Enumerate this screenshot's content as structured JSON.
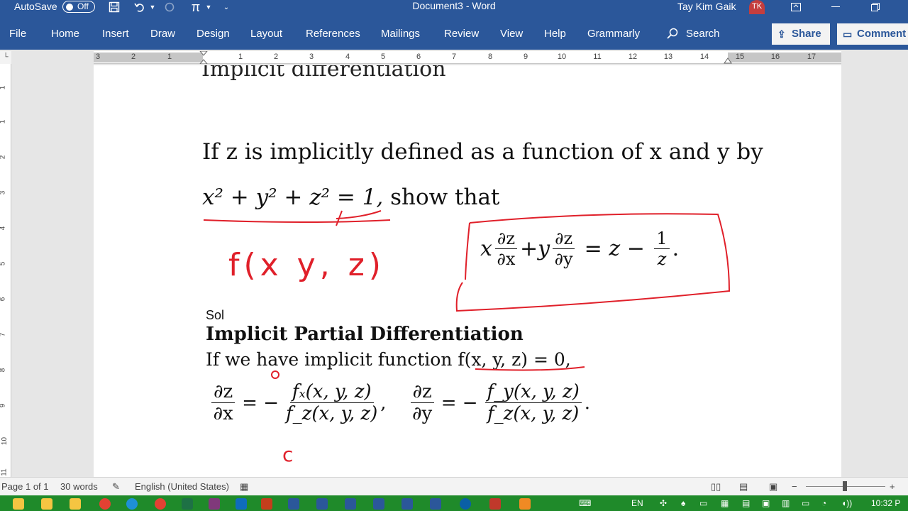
{
  "titlebar": {
    "autosave_label": "AutoSave",
    "autosave_state": "Off",
    "document_title": "Document3 - Word",
    "user_name": "Tay Kim Gaik",
    "user_initials": "TK"
  },
  "ribbon": {
    "tabs": [
      "File",
      "Home",
      "Insert",
      "Draw",
      "Design",
      "Layout",
      "References",
      "Mailings",
      "Review",
      "View",
      "Help",
      "Grammarly"
    ],
    "search_label": "Search",
    "share_label": "Share",
    "comments_label": "Comment"
  },
  "ruler": {
    "h_marks": [
      "3",
      "2",
      "1",
      "1",
      "2",
      "3",
      "4",
      "5",
      "6",
      "7",
      "8",
      "9",
      "10",
      "11",
      "12",
      "13",
      "14",
      "15",
      "16",
      "17"
    ],
    "v_marks": [
      "1",
      "1",
      "2",
      "3",
      "4",
      "5",
      "6",
      "7",
      "8",
      "9",
      "10",
      "11"
    ]
  },
  "document": {
    "heading_fragment": "Implicit differentiation",
    "line1": "If z is implicitly defined as a function of x and y by",
    "line2_eq": "x² + y² + z² = 1,",
    "line2_text": " show that",
    "target": {
      "x": "x",
      "dz": "∂z",
      "dx": "∂x",
      "plus": " + ",
      "y": "y",
      "dy": "∂y",
      "equals": " = z − ",
      "one": "1",
      "z": "z",
      "end": "."
    },
    "sol_label": "Sol",
    "section_title": "Implicit Partial Differentiation",
    "line3": "If we have implicit function f(x, y, z) = 0,",
    "formula": {
      "dz": "∂z",
      "dx": "∂x",
      "dy": "∂y",
      "eq": "= −",
      "fx": "fₓ(x, y, z)",
      "fy": "f_y(x, y, z)",
      "fz": "f_z(x, y, z)",
      "comma": ",",
      "period": "."
    },
    "handwriting": {
      "f_xyz": "f(x y, z)",
      "c_note": "c"
    }
  },
  "statusbar": {
    "page": "Page 1 of 1",
    "words": "30 words",
    "language": "English (United States)"
  },
  "tray": {
    "lang": "EN",
    "time": "10:32 P"
  },
  "colors": {
    "word_blue": "#2b579a",
    "ink_red": "#e0202a",
    "taskbar_green": "#1f8a2a"
  }
}
